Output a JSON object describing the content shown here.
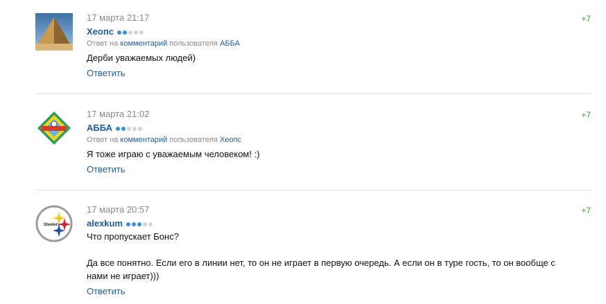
{
  "comments": [
    {
      "date": "17 марта 21:17",
      "author": "Хеопс",
      "rating_level": 2,
      "reply_prefix": "Ответ на",
      "reply_link": "комментарий",
      "reply_mid": "пользователя",
      "reply_user": "АББА",
      "text": "Дерби уважаемых людей)",
      "answer": "Ответить",
      "score": "+7",
      "avatar_icon": "pyramid-icon"
    },
    {
      "date": "17 марта 21:02",
      "author": "АББА",
      "rating_level": 2,
      "reply_prefix": "Ответ на",
      "reply_link": "комментарий",
      "reply_mid": "пользователя",
      "reply_user": "Хеопс",
      "text": "Я тоже играю с уважаемым человеком! :)",
      "answer": "Ответить",
      "score": "+7",
      "avatar_icon": "club-emblem-icon"
    },
    {
      "date": "17 марта 20:57",
      "author": "alexkum",
      "rating_level": 3,
      "text": "Что пропускает Бонс?\n\nДа все понятно. Если его в линии нет, то он не играет в первую очередь. А если он в туре гость, то он вообще с нами не играет)))",
      "answer": "Ответить",
      "score": "+7",
      "avatar_icon": "steelers-logo-icon",
      "avatar_logo_text": "Steelers"
    }
  ],
  "colors": {
    "link": "#1f5c99",
    "score": "#3c9a3c",
    "meta": "#888888",
    "dot_on": "#3a8fd8",
    "dot_off": "#d4d4d4"
  }
}
